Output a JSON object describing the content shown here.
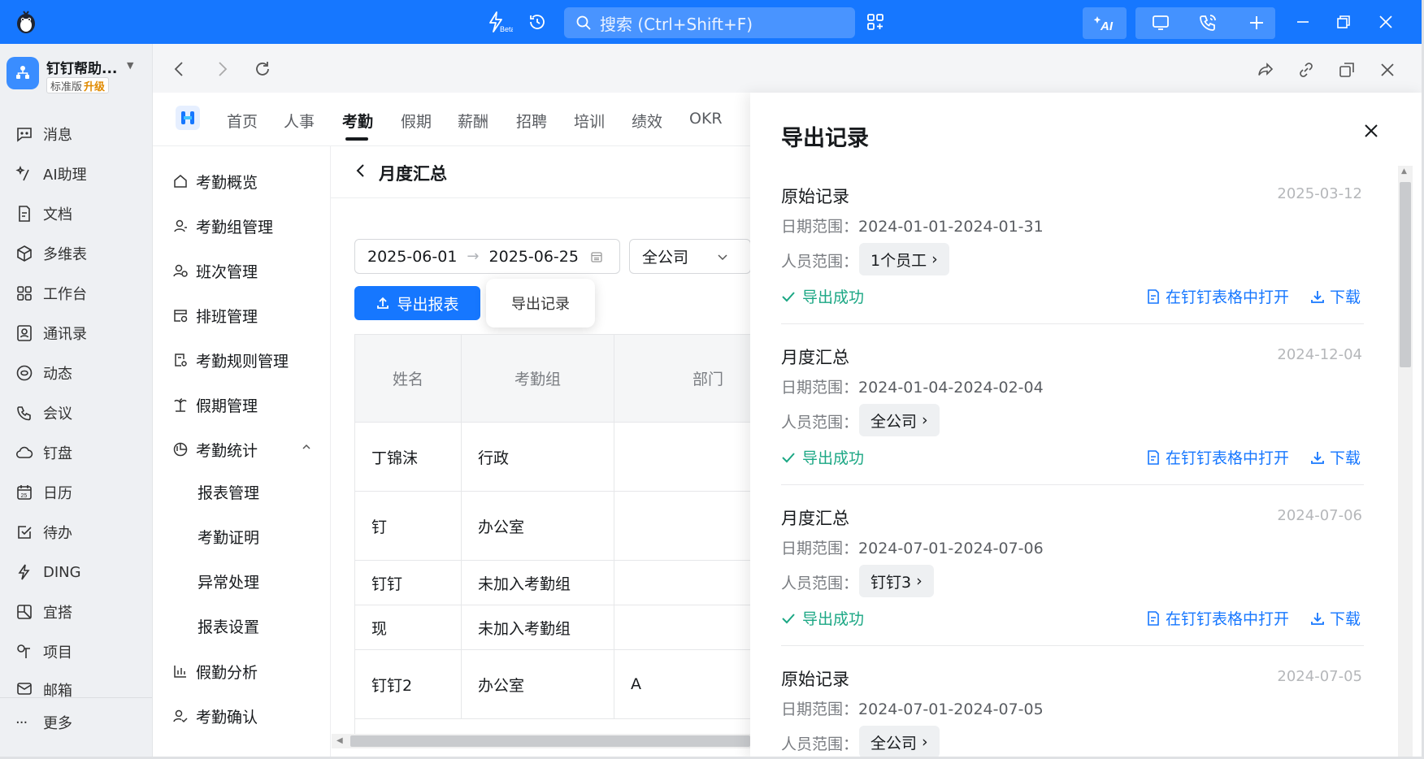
{
  "titlebar": {
    "search_placeholder": "搜索 (Ctrl+Shift+F)",
    "beta_label": "Beta",
    "ai_label": "AI",
    "accent": "#1677ff"
  },
  "org": {
    "name": "钉钉帮助...",
    "edition": "标准版",
    "upgrade": "升级"
  },
  "rail": {
    "items": [
      {
        "label": "消息",
        "icon": "message-icon"
      },
      {
        "label": "AI助理",
        "icon": "ai-assistant-icon"
      },
      {
        "label": "文档",
        "icon": "document-icon"
      },
      {
        "label": "多维表",
        "icon": "table-cube-icon"
      },
      {
        "label": "工作台",
        "icon": "workbench-icon"
      },
      {
        "label": "通讯录",
        "icon": "contacts-icon"
      },
      {
        "label": "动态",
        "icon": "feed-icon"
      },
      {
        "label": "会议",
        "icon": "meeting-icon"
      },
      {
        "label": "钉盘",
        "icon": "cloud-drive-icon"
      },
      {
        "label": "日历",
        "icon": "calendar-icon"
      },
      {
        "label": "待办",
        "icon": "todo-icon"
      },
      {
        "label": "DING",
        "icon": "ding-icon"
      },
      {
        "label": "宜搭",
        "icon": "yida-icon"
      },
      {
        "label": "项目",
        "icon": "project-icon"
      },
      {
        "label": "邮箱",
        "icon": "mail-icon"
      }
    ],
    "more": "更多"
  },
  "app_tabs": [
    "首页",
    "人事",
    "考勤",
    "假期",
    "薪酬",
    "招聘",
    "培训",
    "绩效",
    "OKR"
  ],
  "active_tab": "考勤",
  "subnav": {
    "items": [
      "考勤概览",
      "考勤组管理",
      "班次管理",
      "排班管理",
      "考勤规则管理",
      "假期管理",
      "考勤统计"
    ],
    "stats_children": [
      "报表管理",
      "考勤证明",
      "异常处理",
      "报表设置"
    ],
    "after": [
      "假勤分析",
      "考勤确认"
    ]
  },
  "page": {
    "title": "月度汇总",
    "date_start": "2025-06-01",
    "date_end": "2025-06-25",
    "company": "全公司",
    "export_button": "导出报表",
    "records_button": "导出记录"
  },
  "table": {
    "headers": [
      "姓名",
      "考勤组",
      "部门"
    ],
    "rows": [
      [
        "丁锦沫",
        "行政",
        ""
      ],
      [
        "钉",
        "办公室",
        ""
      ],
      [
        "钉钉",
        "未加入考勤组",
        ""
      ],
      [
        "现",
        "未加入考勤组",
        ""
      ],
      [
        "钉钉2",
        "办公室",
        "A"
      ]
    ]
  },
  "drawer": {
    "title": "导出记录",
    "range_label": "日期范围：",
    "people_label": "人员范围：",
    "open_label": "在钉钉表格中打开",
    "download_label": "下载",
    "records": [
      {
        "title": "原始记录",
        "date": "2025-03-12",
        "range": "2024-01-01-2024-01-31",
        "people": "1个员工",
        "status": "导出成功"
      },
      {
        "title": "月度汇总",
        "date": "2024-12-04",
        "range": "2024-01-04-2024-02-04",
        "people": "全公司",
        "status": "导出成功"
      },
      {
        "title": "月度汇总",
        "date": "2024-07-06",
        "range": "2024-07-01-2024-07-06",
        "people": "钉钉3",
        "status": "导出成功"
      },
      {
        "title": "原始记录",
        "date": "2024-07-05",
        "range": "2024-07-01-2024-07-05",
        "people": "全公司"
      }
    ]
  }
}
